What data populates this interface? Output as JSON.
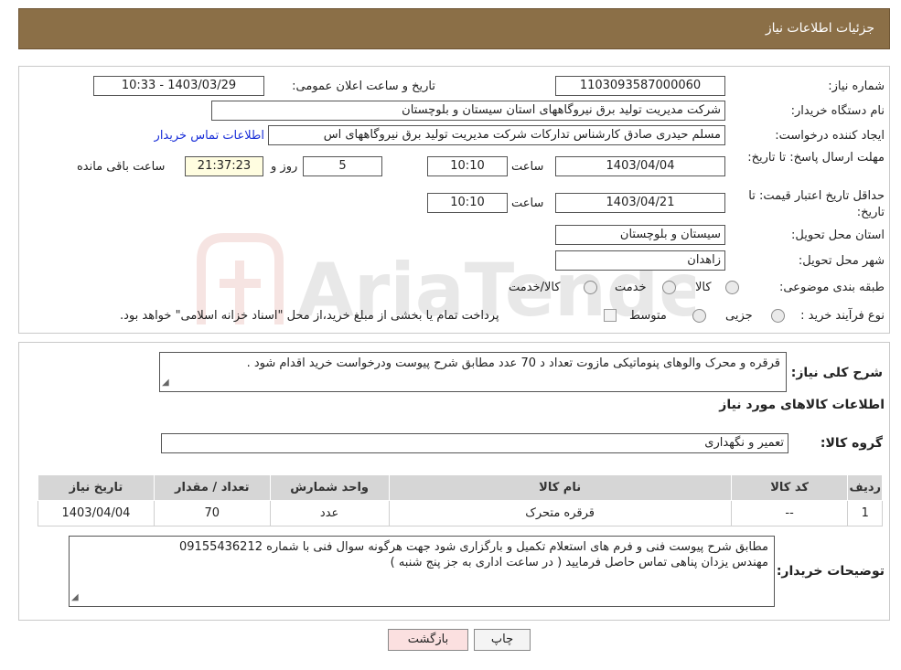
{
  "header": {
    "title": "جزئیات اطلاعات نیاز"
  },
  "form": {
    "need_number": {
      "label": "شماره نیاز:",
      "value": "1103093587000060"
    },
    "announce_datetime": {
      "label": "تاریخ و ساعت اعلان عمومی:",
      "value": "1403/03/29 - 10:33"
    },
    "buyer_org": {
      "label": "نام دستگاه خریدار:",
      "value": "شرکت مدیریت تولید برق نیروگاههای استان سیستان و بلوچستان"
    },
    "requester": {
      "label": "ایجاد کننده درخواست:",
      "value": "مسلم حیدری صادق کارشناس تدارکات شرکت مدیریت تولید برق نیروگاههای اس",
      "contact_link": "اطلاعات تماس خریدار"
    },
    "reply_deadline": {
      "label": "مهلت ارسال پاسخ: تا تاریخ:",
      "date": "1403/04/04",
      "time_label": "ساعت",
      "time": "10:10",
      "days": "5",
      "days_label": "روز و",
      "remaining": "21:37:23",
      "remaining_label": "ساعت باقی مانده"
    },
    "price_validity": {
      "label": "حداقل تاریخ اعتبار قیمت: تا تاریخ:",
      "date": "1403/04/21",
      "time_label": "ساعت",
      "time": "10:10"
    },
    "delivery_province": {
      "label": "استان محل تحویل:",
      "value": "سیستان و بلوچستان"
    },
    "delivery_city": {
      "label": "شهر محل تحویل:",
      "value": "زاهدان"
    },
    "category": {
      "label": "طبقه بندی موضوعی:",
      "options": [
        "کالا",
        "خدمت",
        "کالا/خدمت"
      ]
    },
    "purchase_type": {
      "label": "نوع فرآیند خرید :",
      "options": [
        "جزیی",
        "متوسط"
      ],
      "note": "پرداخت تمام یا بخشی از مبلغ خرید،از محل \"اسناد خزانه اسلامی\" خواهد بود."
    }
  },
  "description": {
    "label": "شرح کلی نیاز:",
    "value": "قرقره و محرک والوهای پنوماتیکی مازوت تعداد د 70 عدد  مطابق شرح پیوست  ودرخواست خرید اقدام شود ."
  },
  "goods": {
    "section_title": "اطلاعات کالاهای مورد نیاز",
    "group_label": "گروه کالا:",
    "group_value": "تعمیر و نگهداری",
    "columns": [
      "ردیف",
      "کد کالا",
      "نام کالا",
      "واحد شمارش",
      "تعداد / مقدار",
      "تاریخ نیاز"
    ],
    "rows": [
      {
        "row": "1",
        "code": "--",
        "name": "قرقره متحرک",
        "unit": "عدد",
        "qty": "70",
        "date": "1403/04/04"
      }
    ]
  },
  "buyer_notes": {
    "label": "توضیحات خریدار:",
    "line1": "مطابق شرح پیوست فنی و فرم های استعلام تکمیل و بارگزاری شود  جهت هرگونه سوال فنی با شماره 09155436212",
    "line2": "مهندس یزدان پناهی تماس حاصل فرمایید  ( در ساعت اداری  به جز پنج شنبه )"
  },
  "buttons": {
    "print": "چاپ",
    "back": "بازگشت"
  },
  "watermark": {
    "text": "AriaTender.neT"
  },
  "colors": {
    "header_bg": "#8b6f47",
    "link": "#1a2fd8",
    "back_btn_bg": "#fbe0e0"
  }
}
